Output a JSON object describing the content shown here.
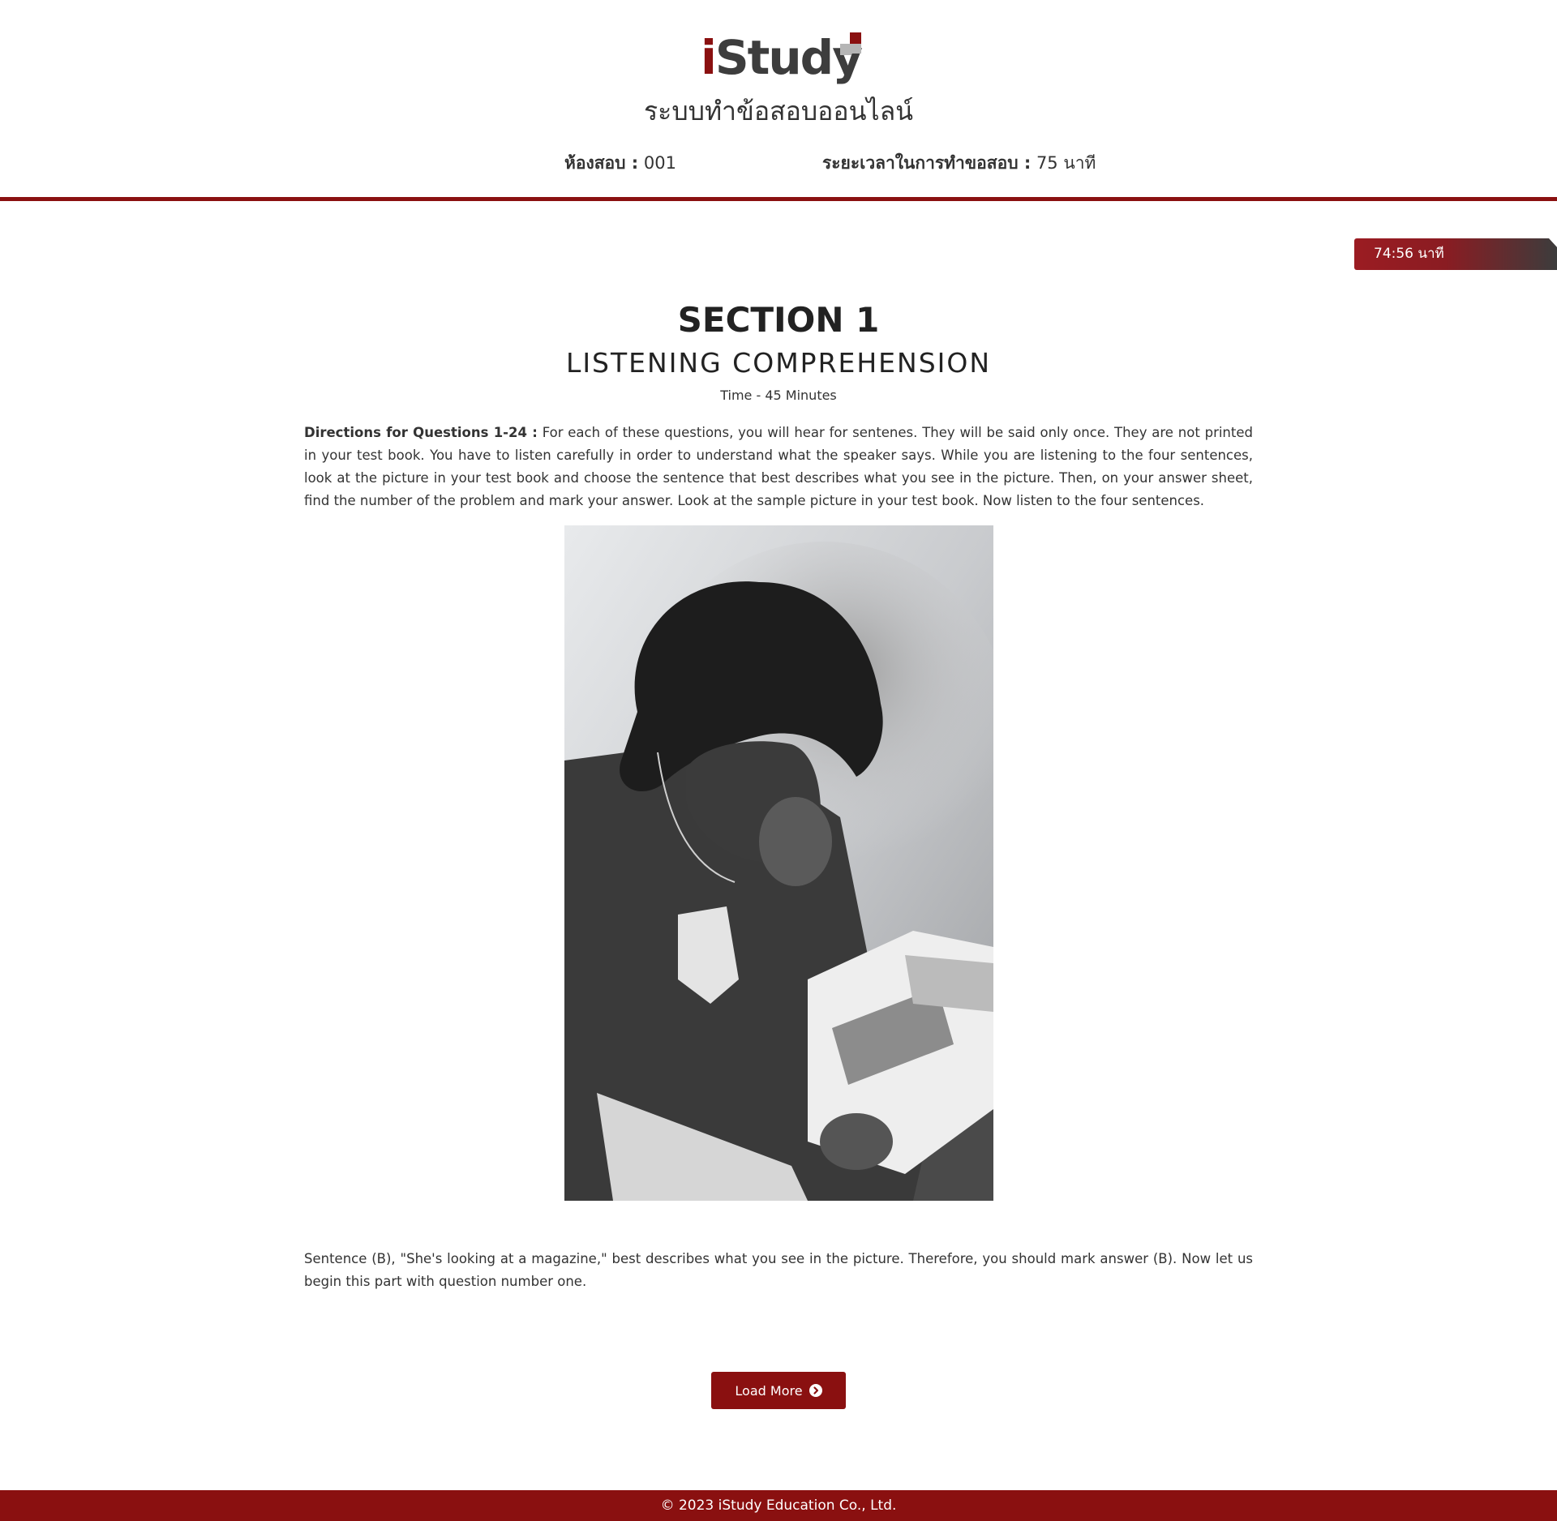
{
  "header": {
    "logo_prefix": "i",
    "logo_rest": "Study",
    "title": "ระบบทำข้อสอบออนไลน์",
    "room_label": "ห้องสอบ :",
    "room_value": "001",
    "duration_label": "ระยะเวลาในการทำขอสอบ :",
    "duration_value": "75 นาที"
  },
  "timer": {
    "text": "74:56 นาที"
  },
  "section": {
    "title": "SECTION 1",
    "subtitle": "LISTENING COMPREHENSION",
    "time": "Time - 45 Minutes"
  },
  "directions": {
    "label": "Directions for Questions 1-24 :",
    "text": " For each of these questions, you will hear for sentenes. They will be said only once. They are not printed in your test book. You have to listen carefully in order to understand what the speaker says. While you are listening to the four sentences, look at the picture in your test book and choose the sentence that best describes what you see in the picture. Then, on your answer sheet, find the number of the problem and mark your answer. Look at the sample picture in your test book. Now listen to the four sentences."
  },
  "example": {
    "sentence": "Sentence (B), \"She's looking at a magazine,\" best describes what you see in the picture. Therefore, you should mark answer (B). Now let us begin this part with question number one."
  },
  "actions": {
    "load_more": "Load More"
  },
  "footer": {
    "text": "© 2023 iStudy Education Co., Ltd."
  },
  "colors": {
    "brand_red": "#8a1010",
    "timer_gradient_end": "#3c3c3c"
  },
  "icons": {
    "load_more_icon": "chevron-circle-right-icon"
  }
}
